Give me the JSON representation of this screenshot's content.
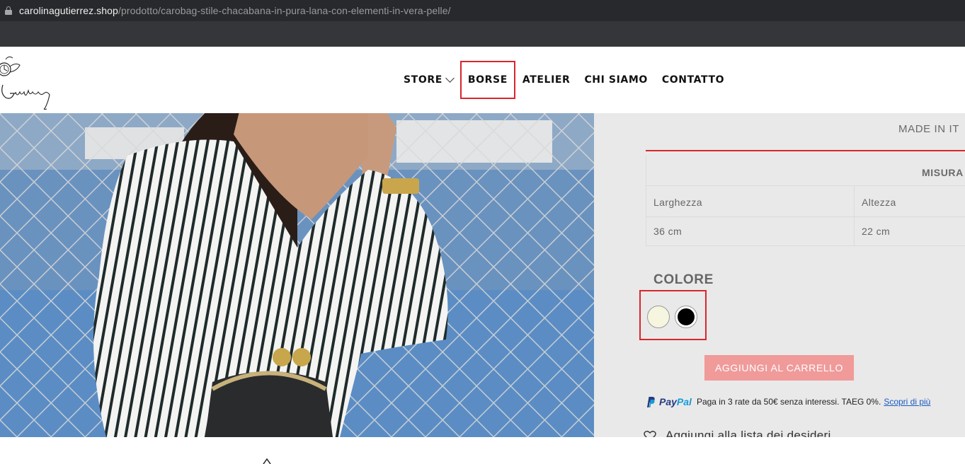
{
  "browser": {
    "url_domain": "carolinagutierrez.shop",
    "url_path": "/prodotto/carobag-stile-chacabana-in-pura-lana-con-elementi-in-vera-pelle/"
  },
  "header": {
    "nav": [
      {
        "label": "STORE"
      },
      {
        "label": "BORSE"
      },
      {
        "label": "ATELIER"
      },
      {
        "label": "CHI SIAMO"
      },
      {
        "label": "CONTATTO"
      }
    ]
  },
  "product": {
    "made_in": "MADE IN IT",
    "size_table": {
      "title": "MISURA",
      "headers": [
        "Larghezza",
        "Altezza"
      ],
      "values": [
        "36 cm",
        "22 cm"
      ]
    },
    "color_label": "COLORE",
    "colors": [
      {
        "name": "cream",
        "hex": "#f5f5e0"
      },
      {
        "name": "black",
        "hex": "#000000"
      }
    ],
    "add_to_cart": "AGGIUNGI AL CARRELLO",
    "paypal": {
      "word_pay": "Pay",
      "word_pal": "Pal",
      "text": "Paga in 3 rate da 50€ senza interessi. TAEG 0%.",
      "link": "Scopri di più"
    },
    "wishlist": "Aggiungi alla lista dei desideri"
  },
  "colors": {
    "accent_red": "#d9262b",
    "cart_button": "#f09a9a",
    "panel_bg": "#e9e9e9"
  }
}
